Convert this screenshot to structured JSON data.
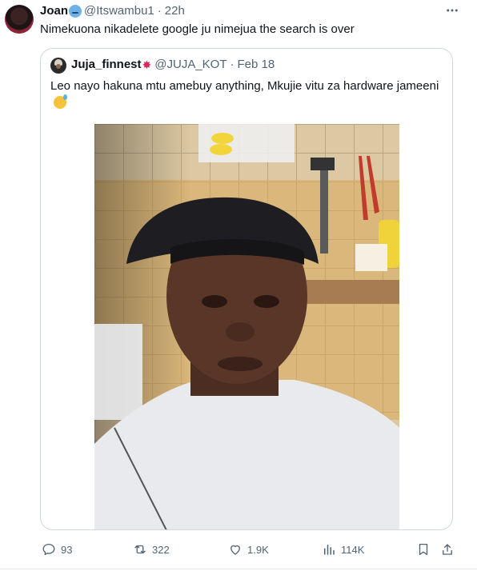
{
  "tweet": {
    "author_name": "Joan",
    "handle": "@Itswambu1",
    "separator": "·",
    "time": "22h",
    "text": "Nimekuona nikadelete google ju nimejua the search is over"
  },
  "quoted": {
    "author_name": "Juja_finnest",
    "handle": "@JUJA_KOT",
    "separator": "·",
    "date": "Feb 18",
    "text": "Leo nayo hakuna mtu amebuy anything, Mkujie vitu za hardware jameeni"
  },
  "actions": {
    "replies": "93",
    "reposts": "322",
    "likes": "1.9K",
    "views": "114K"
  },
  "icons": [
    "verified-emoji-icon",
    "more-icon",
    "burst-emoji-icon",
    "sweat-emoji-icon",
    "reply-icon",
    "repost-icon",
    "like-icon",
    "views-icon",
    "bookmark-icon",
    "share-icon"
  ],
  "colors": {
    "text": "#0f1419",
    "secondary": "#536471",
    "border": "#cfd9de"
  }
}
